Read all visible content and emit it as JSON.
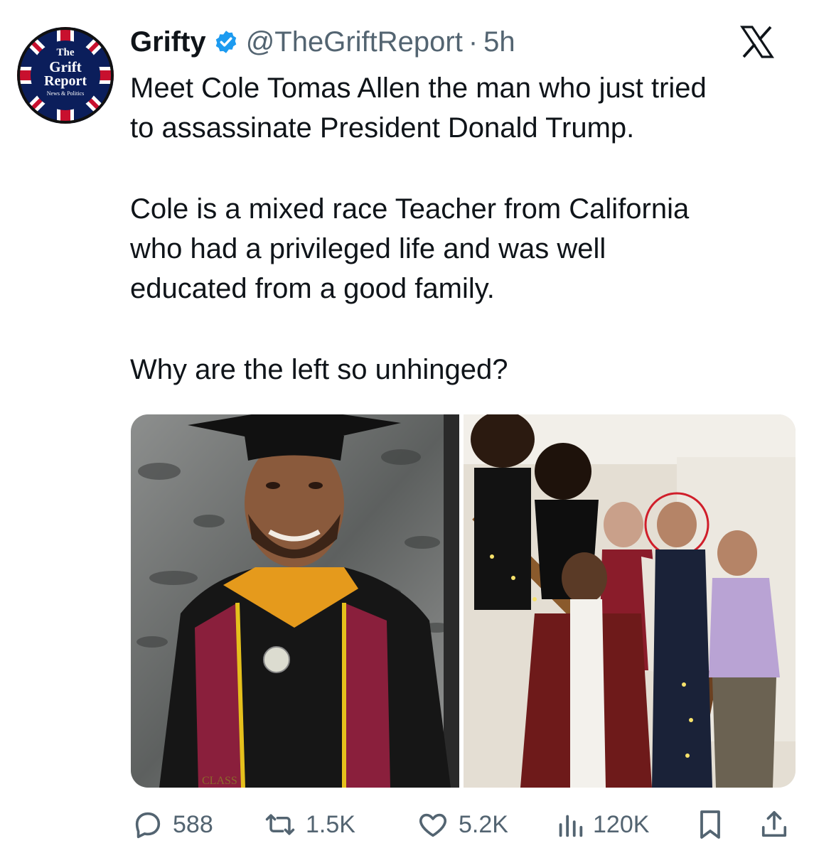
{
  "author": {
    "avatar_logo_lines": [
      "The",
      "Grift",
      "Report",
      "News & Politics"
    ],
    "display_name": "Grifty",
    "verified_icon": "verified-badge-icon",
    "handle": "@TheGriftReport",
    "separator": "·",
    "timestamp": "5h"
  },
  "brand_icon": "x-logo-icon",
  "tweet": {
    "paragraphs": [
      [
        "Meet Cole Tomas Allen the man who just tried",
        "to assassinate President Donald Trump."
      ],
      [
        "Cole is a mixed race Teacher from California",
        "who had a privileged life and was well",
        "educated from a good family."
      ],
      [
        "Why are the left so unhinged?"
      ]
    ]
  },
  "media": {
    "images": [
      {
        "name": "graduation-photo",
        "caption_text": "CLASS"
      },
      {
        "name": "family-photo"
      }
    ]
  },
  "actions": {
    "reply": {
      "icon": "reply-icon",
      "count": "588"
    },
    "retweet": {
      "icon": "retweet-icon",
      "count": "1.5K"
    },
    "like": {
      "icon": "heart-icon",
      "count": "5.2K"
    },
    "views": {
      "icon": "views-icon",
      "count": "120K"
    },
    "bookmark": {
      "icon": "bookmark-icon"
    },
    "share": {
      "icon": "share-icon"
    }
  },
  "colors": {
    "text_primary": "#0f1419",
    "text_secondary": "#536471",
    "verified_blue": "#1d9bf0",
    "logo_navy": "#0b1e5b",
    "logo_red": "#c8102e"
  }
}
